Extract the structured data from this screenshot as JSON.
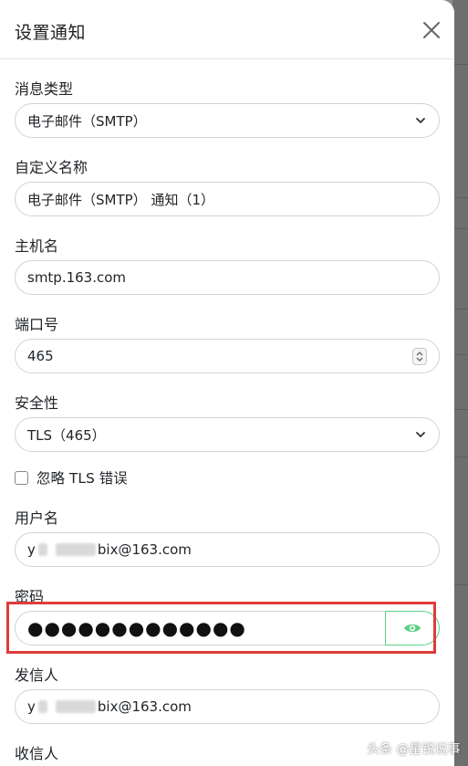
{
  "modal": {
    "title": "设置通知",
    "close_icon": "close-icon"
  },
  "fields": {
    "notification_type": {
      "label": "消息类型",
      "value": "电子邮件（SMTP）"
    },
    "friendly_name": {
      "label": "自定义名称",
      "value": "电子邮件（SMTP） 通知（1）"
    },
    "hostname": {
      "label": "主机名",
      "value": "smtp.163.com"
    },
    "port": {
      "label": "端口号",
      "value": "465"
    },
    "security": {
      "label": "安全性",
      "value": "TLS（465）"
    },
    "ignore_tls": {
      "label": "忽略 TLS 错误",
      "checked": false
    },
    "username": {
      "label": "用户名",
      "value_prefix": "y",
      "value_suffix": "bix@163.com"
    },
    "password": {
      "label": "密码",
      "value": "●●●●●●●●●●●●●",
      "toggle_icon": "eye-icon"
    },
    "from": {
      "label": "发信人",
      "value_prefix": "y",
      "value_suffix": "bix@163.com"
    },
    "to": {
      "label": "收信人"
    }
  },
  "colors": {
    "accent": "#5cd083",
    "highlight": "#e03b3b"
  },
  "watermark": {
    "text": "头条 @星锐说事"
  }
}
